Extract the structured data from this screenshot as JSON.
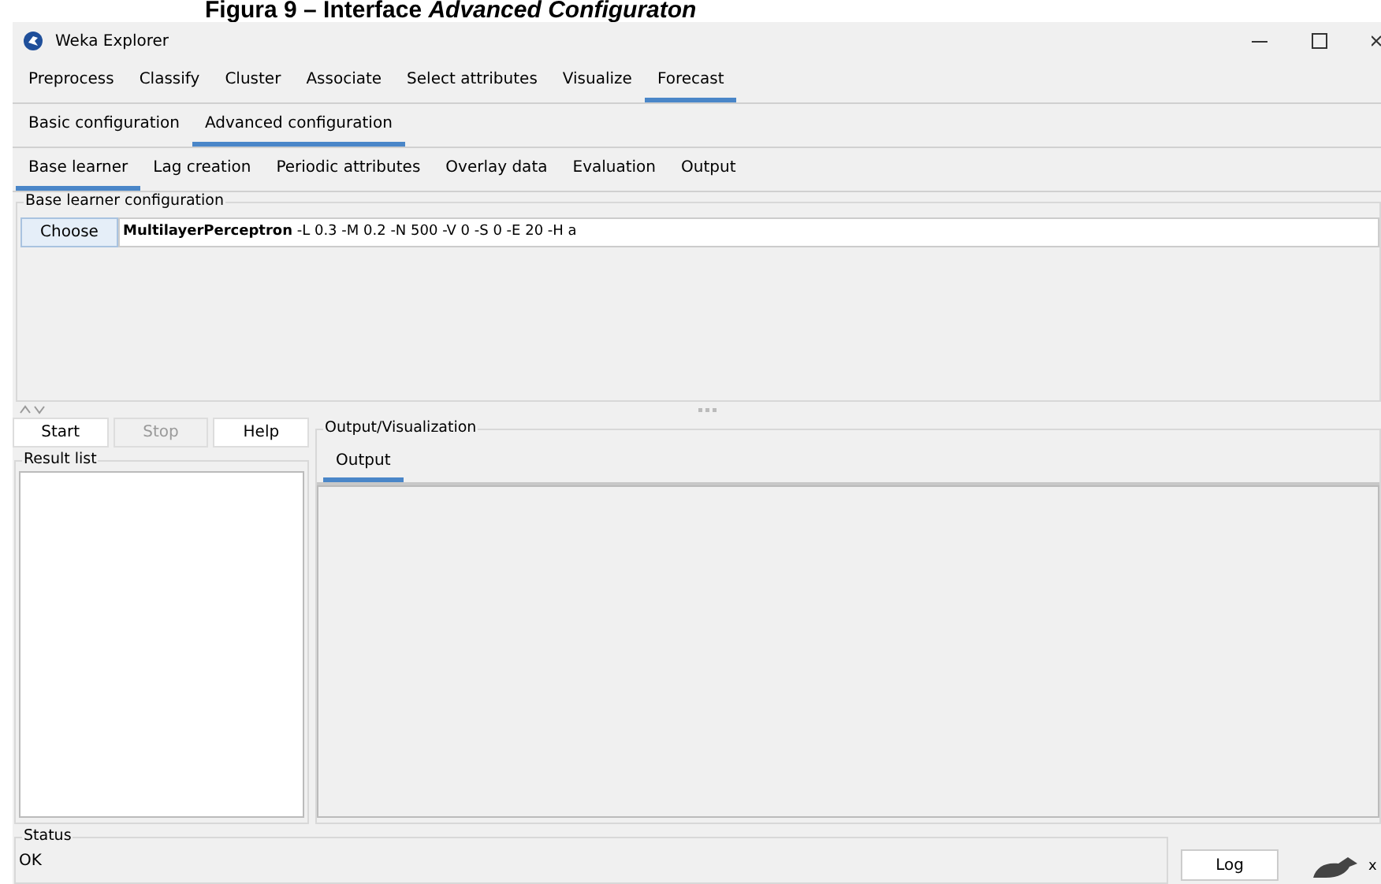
{
  "caption": "Figura 9 – Interface *Advanced Configuraton*",
  "window": {
    "title": "Weka Explorer"
  },
  "main_tabs": [
    {
      "label": "Preprocess",
      "selected": false
    },
    {
      "label": "Classify",
      "selected": false
    },
    {
      "label": "Cluster",
      "selected": false
    },
    {
      "label": "Associate",
      "selected": false
    },
    {
      "label": "Select attributes",
      "selected": false
    },
    {
      "label": "Visualize",
      "selected": false
    },
    {
      "label": "Forecast",
      "selected": true
    }
  ],
  "config_tabs": [
    {
      "label": "Basic configuration",
      "selected": false
    },
    {
      "label": "Advanced configuration",
      "selected": true
    }
  ],
  "learner_tabs": [
    {
      "label": "Base learner",
      "selected": true
    },
    {
      "label": "Lag creation",
      "selected": false
    },
    {
      "label": "Periodic attributes",
      "selected": false
    },
    {
      "label": "Overlay data",
      "selected": false
    },
    {
      "label": "Evaluation",
      "selected": false
    },
    {
      "label": "Output",
      "selected": false
    }
  ],
  "base_learner": {
    "group_title": "Base learner configuration",
    "button": "Choose",
    "classifier": "**MultilayerPerceptron** -L 0.3 -M 0.2 -N 500 -V 0 -S 0 -E 20 -H a"
  },
  "run_buttons": [
    {
      "label": "Start",
      "disabled": false
    },
    {
      "label": "Stop",
      "disabled": true
    },
    {
      "label": "Help",
      "disabled": false
    }
  ],
  "result_list": {
    "title": "Result list"
  },
  "output": {
    "title": "Output/Visualization",
    "tabs": [
      {
        "label": "Output",
        "selected": true
      }
    ]
  },
  "status": {
    "title": "Status",
    "message": "OK"
  },
  "log_button": "Log",
  "bird_mark": "x"
}
